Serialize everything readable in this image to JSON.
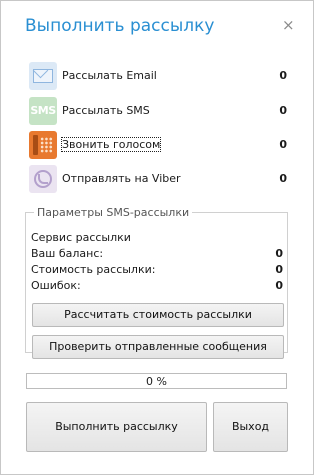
{
  "window": {
    "title": "Выполнить рассылку",
    "close_glyph": "×"
  },
  "channels": [
    {
      "icon": "email-icon",
      "icon_text": "",
      "label": "Рассылать Email",
      "count": "0"
    },
    {
      "icon": "sms-icon",
      "icon_text": "SMS",
      "label": "Рассылать SMS",
      "count": "0"
    },
    {
      "icon": "phone-icon",
      "icon_text": "",
      "label": "Звонить голосом",
      "count": "0"
    },
    {
      "icon": "viber-icon",
      "icon_text": "",
      "label": "Отправлять на Viber",
      "count": "0"
    }
  ],
  "sms_params": {
    "legend": "Параметры SMS-рассылки",
    "service_label": "Сервис рассылки",
    "service_value": "",
    "balance_label": "Ваш баланс:",
    "balance_value": "0",
    "cost_label": "Стоимость рассылки:",
    "cost_value": "0",
    "errors_label": "Ошибок:",
    "errors_value": "0",
    "calc_button": "Рассчитать стоимость рассылки",
    "check_button": "Проверить отправленные сообщения"
  },
  "progress": {
    "fraction": 0,
    "text": "0 %"
  },
  "footer": {
    "run_button": "Выполнить рассылку",
    "exit_button": "Выход"
  },
  "colors": {
    "title": "#2a8fd2",
    "email_icon_bg": "#dce9f6",
    "sms_icon_bg": "#c5e3c5",
    "phone_icon_bg": "#e8792f",
    "viber_icon_bg": "#ebe4f1"
  }
}
